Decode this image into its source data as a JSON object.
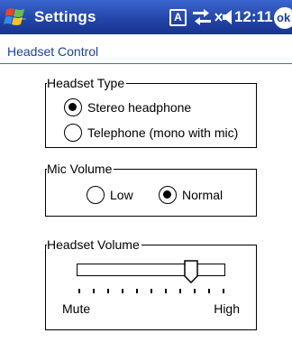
{
  "titlebar": {
    "title": "Settings",
    "tray_a_label": "A",
    "time": "12:11",
    "ok_label": "ok",
    "background": "#2446a8",
    "start_logo_icon": "windows-flag-icon",
    "connectivity_icon": "connectivity-arrows-icon",
    "speaker_icon": "speaker-muted-icon"
  },
  "section": {
    "title": "Headset Control",
    "accent": "#1e3f9f"
  },
  "headset_type": {
    "legend": "Headset Type",
    "options": [
      {
        "label": "Stereo headphone",
        "checked": true
      },
      {
        "label": "Telephone (mono with mic)",
        "checked": false
      }
    ]
  },
  "mic_volume": {
    "legend": "Mic Volume",
    "options": [
      {
        "label": "Low",
        "checked": false
      },
      {
        "label": "Normal",
        "checked": true
      }
    ]
  },
  "headset_volume": {
    "legend": "Headset Volume",
    "min_label": "Mute",
    "max_label": "High",
    "level_fraction": 0.8,
    "tick_count": 11
  }
}
